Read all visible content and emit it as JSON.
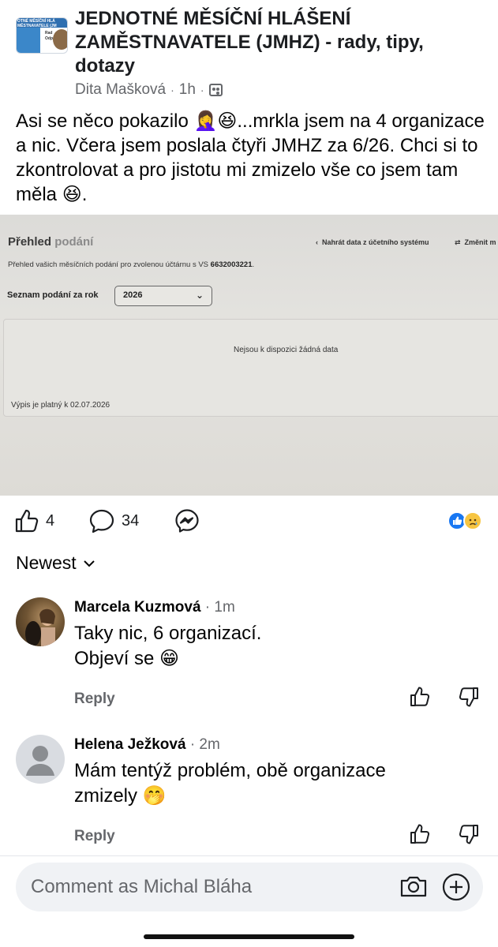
{
  "post": {
    "group_name": "JEDNOTNÉ MĚSÍČNÍ HLÁŠENÍ ZAMĚSTNAVATELE (JMHZ) - rady, tipy, dotazy",
    "group_avatar_text": "OTNÉ MĚSÍČNÍ HLÁ MĚSTNAVATELE (JM",
    "group_avatar_side": "Rad\nOdp",
    "author": "Dita Mašková",
    "separator": "·",
    "time": "1h",
    "privacy_icon": "group-icon",
    "text": "Asi se něco pokazilo 🤦‍♀️😆...mrkla jsem na 4 organizace a nic. Včera jsem poslala čtyři JMHZ za 6/26. Chci si to zkontrolovat a pro jistotu mi zmizelo vše co jsem tam měla 😆."
  },
  "photo": {
    "title_main": "Přehled ",
    "title_faded": "podání",
    "nav_back": "Nahrát data z účetního systému",
    "nav_change": "Změnit m",
    "description_prefix": "Přehled vašich měsíčních podání pro zvolenou účtárnu s VS ",
    "description_vs": "6632003221",
    "description_suffix": ".",
    "year_label": "Seznam podání za rok",
    "year_value": "2026",
    "no_data": "Nejsou k dispozici žádná data",
    "valid_until": "Výpis je platný k 02.07.2026"
  },
  "actions": {
    "like_count": "4",
    "comment_count": "34",
    "reaction_colors": [
      "#1877f2",
      "#f7c542"
    ]
  },
  "sort": {
    "label": "Newest"
  },
  "comments": [
    {
      "name": "Marcela Kuzmová",
      "time": "1m",
      "line1": "Taky nic, 6 organizací.",
      "line2": "Objeví se 😁",
      "reply": "Reply"
    },
    {
      "name": "Helena Ježková",
      "time": "2m",
      "line1": "Mám tentýž problém, obě organizace",
      "line2": "zmizely 🤭",
      "reply": "Reply"
    }
  ],
  "composer": {
    "placeholder": "Comment as Michal Bláha"
  }
}
